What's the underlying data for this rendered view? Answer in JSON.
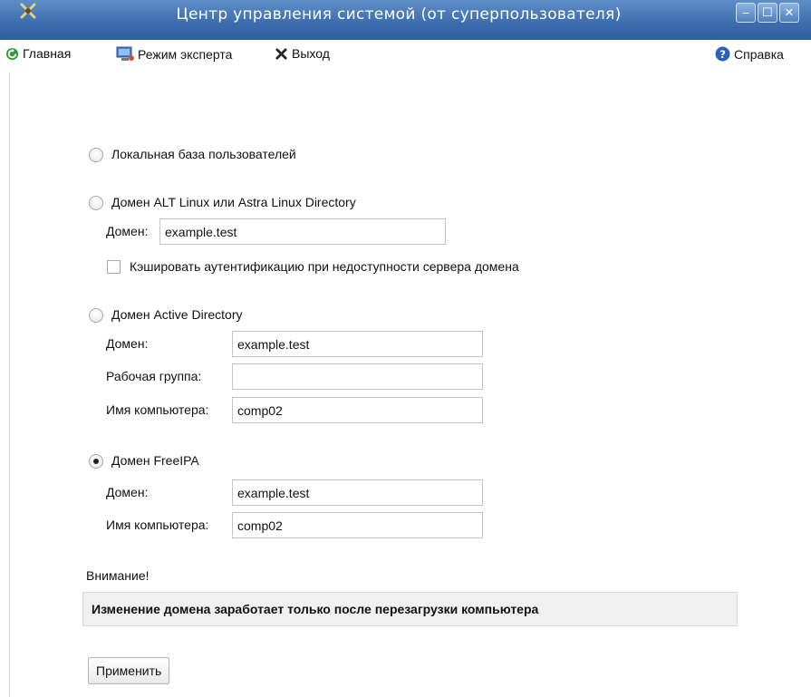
{
  "window": {
    "title": "Центр управления системой (от суперпользователя)",
    "min_glyph": "–",
    "max_glyph": "☐",
    "close_glyph": "✕"
  },
  "toolbar": {
    "home_label": "Главная",
    "expert_label": "Режим эксперта",
    "exit_label": "Выход",
    "help_label": "Справка"
  },
  "auth": {
    "local": {
      "label": "Локальная база пользователей",
      "selected": false
    },
    "alt": {
      "label": "Домен ALT Linux или Astra Linux Directory",
      "selected": false,
      "domain_label": "Домен:",
      "domain_value": "example.test",
      "cache_label": "Кэшировать аутентификацию при недоступности сервера домена",
      "cache_checked": false
    },
    "ad": {
      "label": "Домен Active Directory",
      "selected": false,
      "domain_label": "Домен:",
      "domain_value": "example.test",
      "workgroup_label": "Рабочая группа:",
      "workgroup_value": "",
      "computer_label": "Имя компьютера:",
      "computer_value": "comp02"
    },
    "freeipa": {
      "label": "Домен FreeIPA",
      "selected": true,
      "domain_label": "Домен:",
      "domain_value": "example.test",
      "computer_label": "Имя компьютера:",
      "computer_value": "comp02"
    }
  },
  "notice": {
    "heading": "Внимание!",
    "text": "Изменение домена заработает только после перезагрузки компьютера"
  },
  "apply_label": "Применить",
  "colors": {
    "titlebar": "#3d6fae",
    "accent": "#2a62b8"
  }
}
